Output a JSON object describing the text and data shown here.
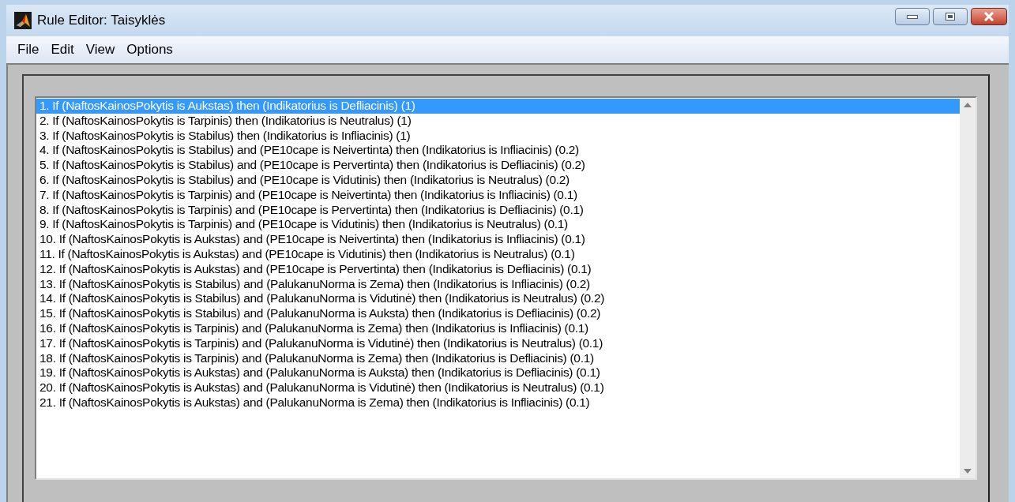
{
  "window": {
    "title": "Rule Editor: Taisyklės"
  },
  "menu": [
    "File",
    "Edit",
    "View",
    "Options"
  ],
  "rules": [
    {
      "text": "1. If (NaftosKainosPokytis is Aukstas) then (Indikatorius is Defliacinis) (1)",
      "selected": true
    },
    {
      "text": "2. If (NaftosKainosPokytis is Tarpinis) then (Indikatorius is Neutralus) (1)",
      "selected": false
    },
    {
      "text": "3. If (NaftosKainosPokytis is Stabilus) then (Indikatorius is Infliacinis) (1)",
      "selected": false
    },
    {
      "text": "4. If (NaftosKainosPokytis is Stabilus) and (PE10cape is Neivertinta) then (Indikatorius is Infliacinis) (0.2)",
      "selected": false
    },
    {
      "text": "5. If (NaftosKainosPokytis is Stabilus) and (PE10cape is Pervertinta) then (Indikatorius is Defliacinis) (0.2)",
      "selected": false
    },
    {
      "text": "6. If (NaftosKainosPokytis is Stabilus) and (PE10cape is Vidutinis) then (Indikatorius is Neutralus) (0.2)",
      "selected": false
    },
    {
      "text": "7. If (NaftosKainosPokytis is Tarpinis) and (PE10cape is Neivertinta) then (Indikatorius is Infliacinis) (0.1)",
      "selected": false
    },
    {
      "text": "8. If (NaftosKainosPokytis is Tarpinis) and (PE10cape is Pervertinta) then (Indikatorius is Defliacinis) (0.1)",
      "selected": false
    },
    {
      "text": "9. If (NaftosKainosPokytis is Tarpinis) and (PE10cape is Vidutinis) then (Indikatorius is Neutralus) (0.1)",
      "selected": false
    },
    {
      "text": "10. If (NaftosKainosPokytis is Aukstas) and (PE10cape is Neivertinta) then (Indikatorius is Infliacinis) (0.1)",
      "selected": false
    },
    {
      "text": "11. If (NaftosKainosPokytis is Aukstas) and (PE10cape is Vidutinis) then (Indikatorius is Neutralus) (0.1)",
      "selected": false
    },
    {
      "text": "12. If (NaftosKainosPokytis is Aukstas) and (PE10cape is Pervertinta) then (Indikatorius is Defliacinis) (0.1)",
      "selected": false
    },
    {
      "text": "13. If (NaftosKainosPokytis is Stabilus) and (PalukanuNorma is Zema) then (Indikatorius is Infliacinis) (0.2)",
      "selected": false
    },
    {
      "text": "14. If (NaftosKainosPokytis is Stabilus) and (PalukanuNorma is Vidutinė) then (Indikatorius is Neutralus) (0.2)",
      "selected": false
    },
    {
      "text": "15. If (NaftosKainosPokytis is Stabilus) and (PalukanuNorma is Auksta) then (Indikatorius is Defliacinis) (0.2)",
      "selected": false
    },
    {
      "text": "16. If (NaftosKainosPokytis is Tarpinis) and (PalukanuNorma is Zema) then (Indikatorius is Infliacinis) (0.1)",
      "selected": false
    },
    {
      "text": "17. If (NaftosKainosPokytis is Tarpinis) and (PalukanuNorma is Vidutinė) then (Indikatorius is Neutralus) (0.1)",
      "selected": false
    },
    {
      "text": "18. If (NaftosKainosPokytis is Tarpinis) and (PalukanuNorma is Zema) then (Indikatorius is Defliacinis) (0.1)",
      "selected": false
    },
    {
      "text": "19. If (NaftosKainosPokytis is Aukstas) and (PalukanuNorma is Auksta) then (Indikatorius is Defliacinis) (0.1)",
      "selected": false
    },
    {
      "text": "20. If (NaftosKainosPokytis is Aukstas) and (PalukanuNorma is Vidutinė) then (Indikatorius is Neutralus) (0.1)",
      "selected": false
    },
    {
      "text": "21. If (NaftosKainosPokytis is Aukstas) and (PalukanuNorma is Zema) then (Indikatorius is Infliacinis) (0.1)",
      "selected": false
    }
  ]
}
